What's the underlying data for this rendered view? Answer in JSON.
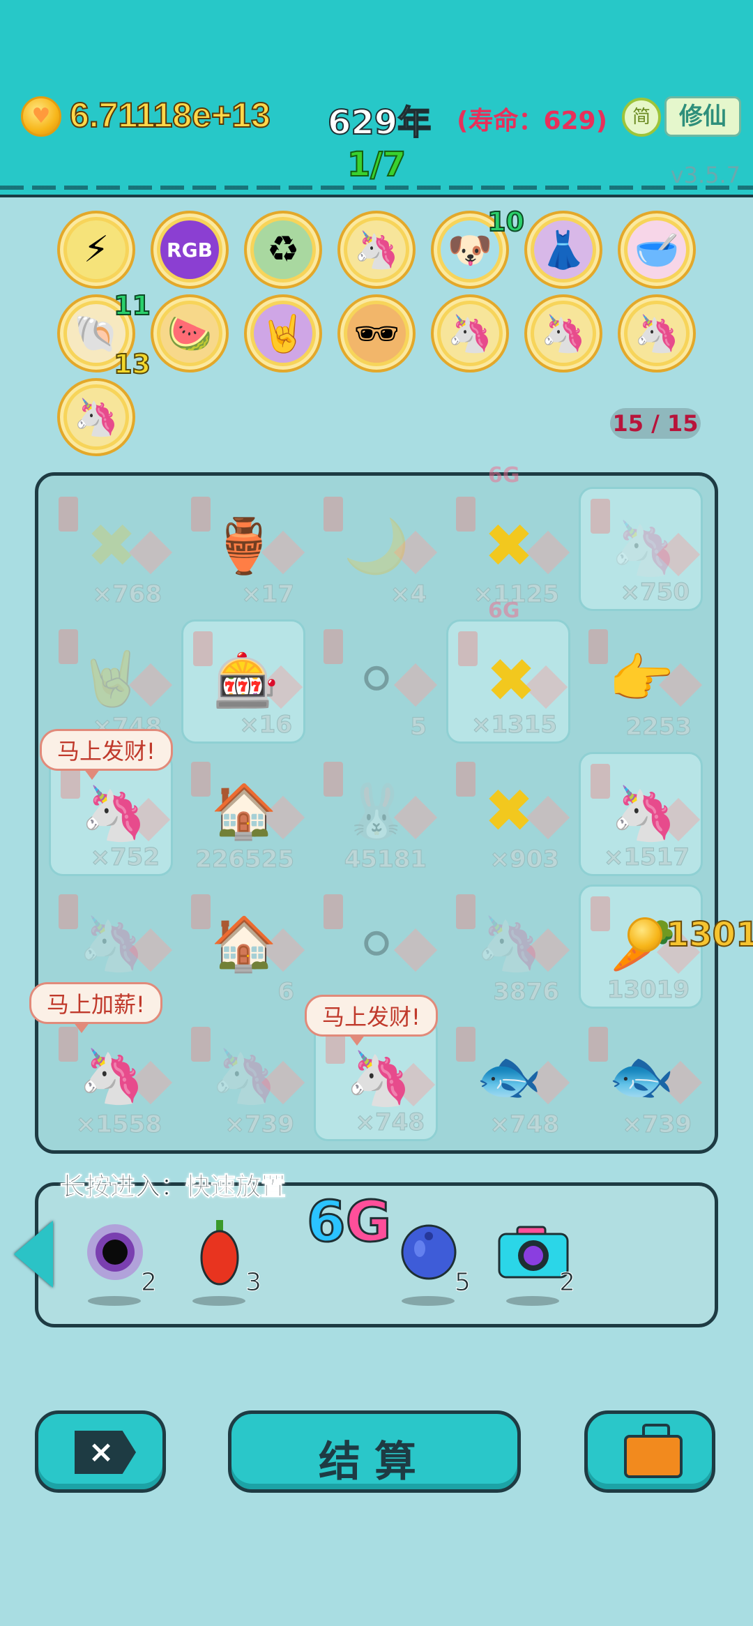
{
  "header": {
    "coins": "6.71118e+13",
    "year": "629年",
    "lifespan": "(寿命：629)",
    "simplified": "简",
    "xiuxian": "修仙",
    "wave": "1/7",
    "version": "v3.5.7"
  },
  "skills": [
    {
      "icon": "lightning-icon",
      "glyph": "⚡",
      "level": ""
    },
    {
      "icon": "rgb-icon",
      "glyph": "RGB",
      "level": ""
    },
    {
      "icon": "recycle-icon",
      "glyph": "♻",
      "level": ""
    },
    {
      "icon": "unicorn-icon",
      "glyph": "🦄",
      "level": ""
    },
    {
      "icon": "dog-icon",
      "glyph": "🐶",
      "level": "10"
    },
    {
      "icon": "skirt-icon",
      "glyph": "👗",
      "level": ""
    },
    {
      "icon": "pin-bowls-icon",
      "glyph": "🥣",
      "level": ""
    },
    {
      "icon": "shell-icon",
      "glyph": "🐚",
      "level": "11",
      "level_b": "13"
    },
    {
      "icon": "fruit-basket-icon",
      "glyph": "🍉",
      "level": ""
    },
    {
      "icon": "rock-hand-icon",
      "glyph": "🤘",
      "level": ""
    },
    {
      "icon": "sunglasses-icon",
      "glyph": "🕶",
      "level": ""
    },
    {
      "icon": "unicorn-icon",
      "glyph": "🦄",
      "level": ""
    },
    {
      "icon": "unicorn-icon",
      "glyph": "🦄",
      "level": ""
    },
    {
      "icon": "unicorn-icon",
      "glyph": "🦄",
      "level": ""
    },
    {
      "icon": "unicorn-icon",
      "glyph": "🦄",
      "level": ""
    }
  ],
  "slot_count": "15 / 15",
  "board": {
    "row1": [
      "×768",
      "×17",
      "×4",
      "×1125",
      "×750"
    ],
    "row2": [
      "×748",
      "×16",
      "5",
      "×1315",
      "2253"
    ],
    "row3": [
      "×752",
      "226525",
      "45181",
      "×903",
      "×1517"
    ],
    "row4": [
      "",
      "6",
      "",
      "3876",
      "13019"
    ],
    "row5": [
      "×1558",
      "×739",
      "×748",
      "×748",
      "×739"
    ],
    "bubble1": "马上发财!",
    "bubble2": "马上加薪!",
    "bubble3": "马上发财!",
    "carrot_amount": "13019",
    "label_6g_small": "6G"
  },
  "tray": {
    "label": "长按进入：快速放置",
    "items": [
      {
        "icon": "black-hole-icon",
        "count": "2"
      },
      {
        "icon": "chili-icon",
        "count": "3"
      },
      {
        "icon": "blueberry-icon",
        "count": "5"
      },
      {
        "icon": "camera-icon",
        "count": "2"
      }
    ],
    "label_6g": "6",
    "label_6g_b": "G"
  },
  "buttons": {
    "close": "×",
    "settle": "结算"
  }
}
